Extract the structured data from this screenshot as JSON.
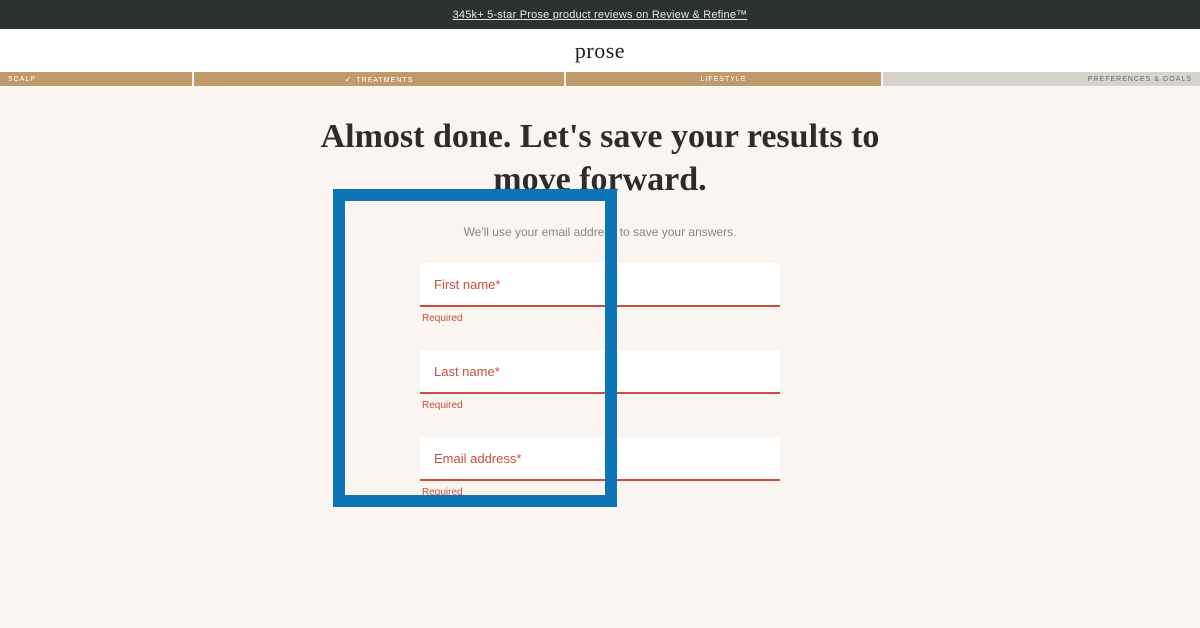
{
  "colors": {
    "accent": "#c19a6b",
    "error": "#c94f3c",
    "highlight": "#0e74b8",
    "topbar_bg": "#2b3332",
    "page_bg": "#faf5f0"
  },
  "topbar": {
    "promo_text": "345k+ 5-star Prose product reviews on Review & Refine™"
  },
  "brand": {
    "name": "prose"
  },
  "progress": {
    "segments": [
      {
        "label": "SCALP",
        "state": "completed",
        "align": "left"
      },
      {
        "label": "TREATMENTS",
        "state": "completed",
        "align": "center",
        "has_check": true
      },
      {
        "label": "LIFESTYLE",
        "state": "active",
        "align": "center"
      },
      {
        "label": "PREFERENCES & GOALS",
        "state": "upcoming",
        "align": "right"
      }
    ]
  },
  "main": {
    "headline": "Almost done. Let's save your results to move forward.",
    "subtext": "We'll use your email address to save your answers."
  },
  "form": {
    "fields": [
      {
        "placeholder": "First name*",
        "error": "Required",
        "name": "first-name"
      },
      {
        "placeholder": "Last name*",
        "error": "Required",
        "name": "last-name"
      },
      {
        "placeholder": "Email address*",
        "error": "Required",
        "name": "email"
      }
    ]
  }
}
